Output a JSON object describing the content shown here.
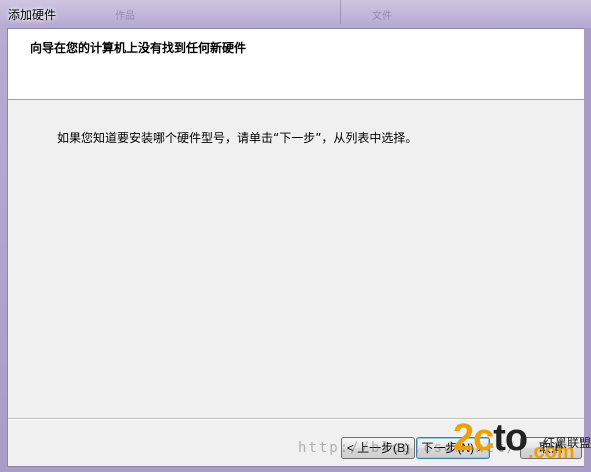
{
  "window": {
    "title": "添加硬件",
    "ghost_left": "作品",
    "ghost_right": "文件"
  },
  "header": {
    "title": "向导在您的计算机上没有找到任何新硬件"
  },
  "main": {
    "instruction": "如果您知道要安装哪个硬件型号，请单击“下一步”，从列表中选择。"
  },
  "buttons": {
    "back": "< 上一步(B)",
    "next": "下一步(N) >",
    "cancel": "取消"
  },
  "watermark": {
    "url": "http://blog.csdn.net/",
    "logo_part1": "2c",
    "logo_part2": "to",
    "logo_suffix": ".com",
    "cn_text": "红黑联盟"
  }
}
